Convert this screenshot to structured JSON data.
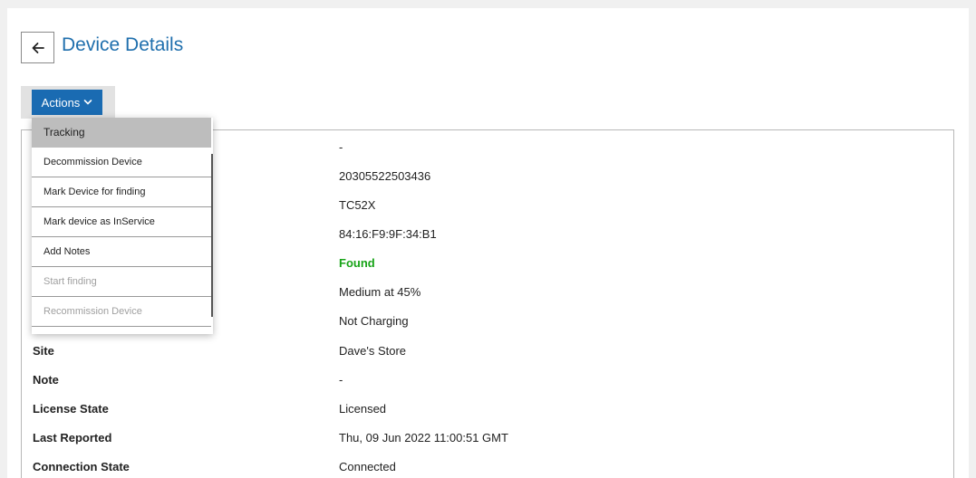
{
  "header": {
    "title": "Device Details",
    "back_icon": "arrow-left-icon"
  },
  "actions": {
    "label": "Actions",
    "chevron_icon": "chevron-down-icon",
    "menu": [
      {
        "label": "Tracking",
        "state": "highlighted"
      },
      {
        "label": "Decommission Device",
        "state": "enabled"
      },
      {
        "label": "Mark Device for finding",
        "state": "enabled"
      },
      {
        "label": "Mark device as InService",
        "state": "enabled"
      },
      {
        "label": "Add Notes",
        "state": "enabled"
      },
      {
        "label": "Start finding",
        "state": "disabled"
      },
      {
        "label": "Recommission Device",
        "state": "disabled"
      }
    ]
  },
  "details": [
    {
      "label": "",
      "value": "-"
    },
    {
      "label": "",
      "value": "20305522503436"
    },
    {
      "label": "",
      "value": "TC52X"
    },
    {
      "label": "",
      "value": "84:16:F9:9F:34:B1"
    },
    {
      "label": "",
      "value": "Found"
    },
    {
      "label": "",
      "value": "Medium at 45%"
    },
    {
      "label": "",
      "value": "Not Charging"
    },
    {
      "label": "Site",
      "value": "Dave's Store"
    },
    {
      "label": "Note",
      "value": "-"
    },
    {
      "label": "License State",
      "value": "Licensed"
    },
    {
      "label": "Last Reported",
      "value": "Thu, 09 Jun 2022 11:00:51 GMT"
    },
    {
      "label": "Connection State",
      "value": "Connected"
    }
  ],
  "colors": {
    "accent": "#1a6bb2",
    "title": "#1f6fad",
    "found": "#17a317"
  }
}
